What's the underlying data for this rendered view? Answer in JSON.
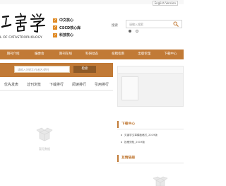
{
  "top": {
    "lang_link": "English Version"
  },
  "header": {
    "logo_subtitle": "L OF CATASTROPHOLOGY",
    "badges": [
      "中文核心",
      "CSCD核心库",
      "科技核心"
    ],
    "search_label": "搜索",
    "search_placeholder": "请输入搜索",
    "radio_selected_index": 0
  },
  "nav": {
    "items": [
      "期刊介绍",
      "编委会",
      "期刊在线",
      "科研动态",
      "投稿指南",
      "出版伦理",
      "下载中心"
    ]
  },
  "banner": {
    "placeholder": "请输入关键字/作者名/期刊",
    "button_label": "检索"
  },
  "tabs": [
    "优先发表",
    "过刊浏览",
    "下载排行",
    "阅读排行",
    "引用排行"
  ],
  "main": {
    "empty_text": "暂无数据"
  },
  "sidebar": {
    "download_center_title": "下载中心",
    "download_items": [
      "灾害学文章模板格式_2019版",
      "投稿须知_2019版"
    ],
    "links_title": "友情链接"
  },
  "colors": {
    "accent": "#c17a36",
    "button_dark": "#8e5a27",
    "badge": "#e08a24"
  }
}
